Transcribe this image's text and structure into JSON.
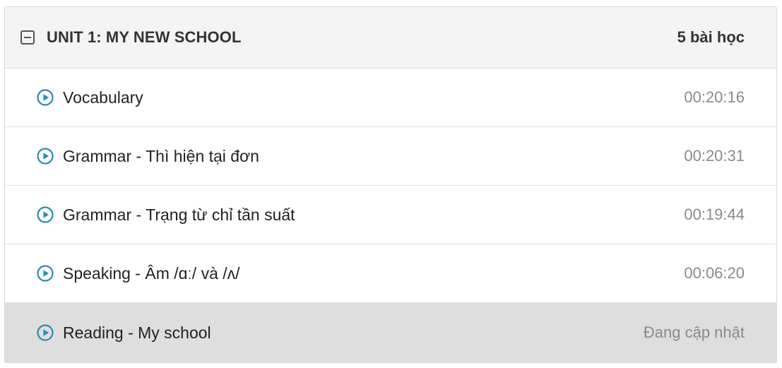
{
  "unit": {
    "title": "UNIT 1: MY NEW SCHOOL",
    "lesson_count": "5 bài học",
    "collapse_icon": "minus-square-icon"
  },
  "lessons": [
    {
      "title": "Vocabulary",
      "duration": "00:20:16",
      "icon": "play-circle-icon",
      "active": false
    },
    {
      "title": "Grammar - Thì hiện tại đơn",
      "duration": "00:20:31",
      "icon": "play-circle-icon",
      "active": false
    },
    {
      "title": "Grammar - Trạng từ chỉ tần suất",
      "duration": "00:19:44",
      "icon": "play-circle-icon",
      "active": false
    },
    {
      "title": "Speaking - Âm /ɑː/ và /ʌ/",
      "duration": "00:06:20",
      "icon": "play-circle-icon",
      "active": false
    },
    {
      "title": "Reading - My school",
      "duration": "Đang cập nhật",
      "icon": "play-circle-icon",
      "active": true
    }
  ],
  "colors": {
    "play_icon": "#2a8bb3",
    "header_bg": "#f4f4f4",
    "active_row_bg": "#dedede"
  }
}
